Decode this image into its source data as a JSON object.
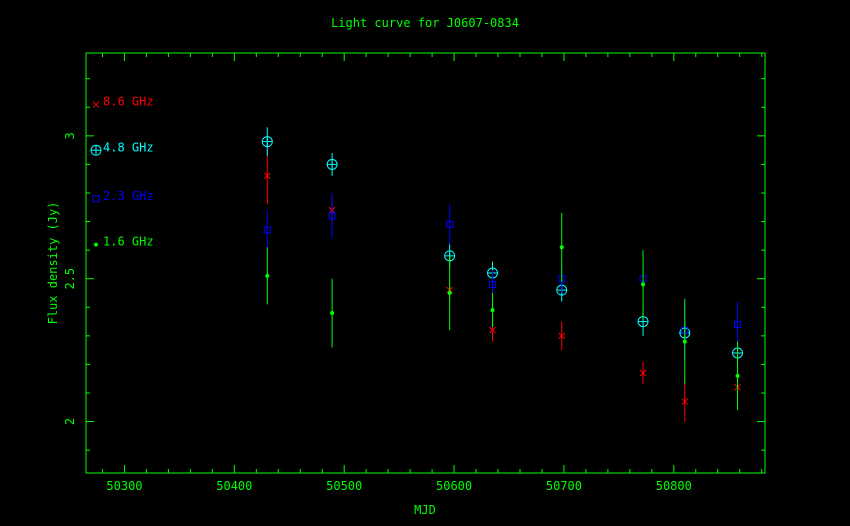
{
  "chart_data": {
    "type": "scatter",
    "title": "Light curve for J0607-0834",
    "xlabel": "MJD",
    "ylabel": "Flux density (Jy)",
    "xlim": [
      50265,
      50883
    ],
    "ylim": [
      1.82,
      3.29
    ],
    "xticks": [
      50300,
      50400,
      50500,
      50600,
      50700,
      50800
    ],
    "yticks": [
      2,
      2.5,
      3
    ],
    "grid": false,
    "legend_position": "left",
    "colors": {
      "background": "#000000",
      "axes": "#00ff00",
      "title": "#00ff00",
      "8.6 GHz": "#ff0000",
      "4.8 GHz": "#00ffff",
      "2.3 GHz": "#0000ff",
      "1.6 GHz": "#00ff00"
    },
    "series": [
      {
        "name": "8.6 GHz",
        "marker": "x",
        "color": "#ff0000",
        "points": [
          {
            "x": 50430,
            "y": 2.86,
            "err": 0.1
          },
          {
            "x": 50489,
            "y": 2.74,
            "err": 0.05
          },
          {
            "x": 50596,
            "y": 2.46,
            "err": 0.03
          },
          {
            "x": 50635,
            "y": 2.32,
            "err": 0.04
          },
          {
            "x": 50698,
            "y": 2.3,
            "err": 0.05
          },
          {
            "x": 50772,
            "y": 2.17,
            "err": 0.04
          },
          {
            "x": 50810,
            "y": 2.07,
            "err": 0.07
          },
          {
            "x": 50858,
            "y": 2.12,
            "err": 0.04
          }
        ]
      },
      {
        "name": "4.8 GHz",
        "marker": "circle-plus",
        "color": "#00ffff",
        "points": [
          {
            "x": 50430,
            "y": 2.98,
            "err": 0.05
          },
          {
            "x": 50489,
            "y": 2.9,
            "err": 0.04
          },
          {
            "x": 50596,
            "y": 2.58,
            "err": 0.04
          },
          {
            "x": 50635,
            "y": 2.52,
            "err": 0.04
          },
          {
            "x": 50698,
            "y": 2.46,
            "err": 0.04
          },
          {
            "x": 50772,
            "y": 2.35,
            "err": 0.05
          },
          {
            "x": 50810,
            "y": 2.31,
            "err": 0.04
          },
          {
            "x": 50858,
            "y": 2.24,
            "err": 0.04
          }
        ]
      },
      {
        "name": "2.3 GHz",
        "marker": "square",
        "color": "#0000ff",
        "points": [
          {
            "x": 50430,
            "y": 2.67,
            "err": 0.07
          },
          {
            "x": 50489,
            "y": 2.72,
            "err": 0.08
          },
          {
            "x": 50596,
            "y": 2.69,
            "err": 0.07
          },
          {
            "x": 50635,
            "y": 2.48,
            "err": 0.05
          },
          {
            "x": 50698,
            "y": 2.5,
            "err": 0.05
          },
          {
            "x": 50772,
            "y": 2.5,
            "err": 0.05
          },
          {
            "x": 50810,
            "y": 2.32,
            "err": 0.11
          },
          {
            "x": 50858,
            "y": 2.34,
            "err": 0.08
          }
        ]
      },
      {
        "name": "1.6 GHz",
        "marker": "dot",
        "color": "#00ff00",
        "points": [
          {
            "x": 50430,
            "y": 2.51,
            "err": 0.1
          },
          {
            "x": 50489,
            "y": 2.38,
            "err": 0.12
          },
          {
            "x": 50596,
            "y": 2.45,
            "err": 0.13
          },
          {
            "x": 50635,
            "y": 2.39,
            "err": 0.06
          },
          {
            "x": 50698,
            "y": 2.61,
            "err": 0.12
          },
          {
            "x": 50772,
            "y": 2.48,
            "err": 0.12
          },
          {
            "x": 50810,
            "y": 2.28,
            "err": 0.15
          },
          {
            "x": 50858,
            "y": 2.16,
            "err": 0.12
          }
        ]
      }
    ]
  }
}
